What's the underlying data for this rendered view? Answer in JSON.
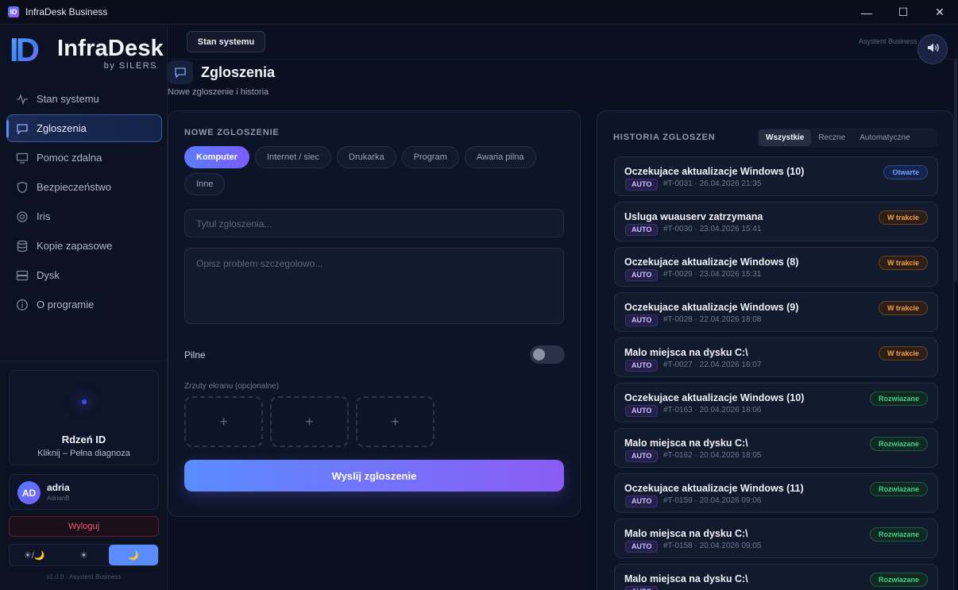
{
  "window": {
    "title": "InfraDesk Business",
    "app_icon": "ID",
    "controls": {
      "minimize": "—",
      "maximize": "☐",
      "close": "✕"
    }
  },
  "logo": {
    "mark": "ID",
    "name": "InfraDesk",
    "by": "by SILERS"
  },
  "sidebar": {
    "items": [
      {
        "label": "Stan systemu",
        "icon": "pulse-icon"
      },
      {
        "label": "Zgloszenia",
        "icon": "chat-icon",
        "active": true
      },
      {
        "label": "Pomoc zdalna",
        "icon": "monitor-icon"
      },
      {
        "label": "Bezpieczeństwo",
        "icon": "shield-icon"
      },
      {
        "label": "Iris",
        "icon": "eye-icon"
      },
      {
        "label": "Kopie zapasowe",
        "icon": "database-icon"
      },
      {
        "label": "Dysk",
        "icon": "server-icon"
      },
      {
        "label": "O programie",
        "icon": "info-icon"
      }
    ],
    "core": {
      "title": "Rdzeń ID",
      "subtitle": "Kliknij – Pełna diagnoza"
    },
    "user": {
      "initials": "AD",
      "name": "adria",
      "sub": "AdrianB"
    },
    "logout": "Wyloguj",
    "theme": {
      "auto": "☀/🌙",
      "light": "☀",
      "dark": "🌙"
    },
    "version": "v1.0.0 · Asystent Business"
  },
  "topbar": {
    "button": "Stan systemu",
    "assistant": "Asystent Business ·"
  },
  "page": {
    "title": "Zgloszenia",
    "subtitle": "Nowe zgloszenie i historia"
  },
  "new_ticket": {
    "label": "NOWE ZGLOSZENIE",
    "categories": [
      "Komputer",
      "Internet / siec",
      "Drukarka",
      "Program",
      "Awaria pilna",
      "Inne"
    ],
    "selected_category": "Komputer",
    "title_placeholder": "Tytul zgloszenia...",
    "desc_placeholder": "Opisz problem szczegolowo...",
    "urgent_label": "Pilne",
    "urgent": false,
    "screens_label": "Zrzuty ekranu (opcjonalne)",
    "slot_glyph": "+",
    "submit": "Wyslij zgloszenie"
  },
  "history": {
    "label": "HISTORIA ZGLOSZEN",
    "tabs": [
      "Wszystkie",
      "Reczne",
      "Automatyczne"
    ],
    "active_tab": "Wszystkie",
    "tickets": [
      {
        "title": "Oczekujace aktualizacje Windows (10)",
        "tag": "AUTO",
        "meta": "#T-0031 · 26.04.2026 21:35",
        "status": "Otwarte",
        "kind": "open"
      },
      {
        "title": "Usluga wuauserv zatrzymana",
        "tag": "AUTO",
        "meta": "#T-0030 · 23.04.2026 15:41",
        "status": "W trakcie",
        "kind": "prog"
      },
      {
        "title": "Oczekujace aktualizacje Windows (8)",
        "tag": "AUTO",
        "meta": "#T-0029 · 23.04.2026 15:31",
        "status": "W trakcie",
        "kind": "prog"
      },
      {
        "title": "Oczekujace aktualizacje Windows (9)",
        "tag": "AUTO",
        "meta": "#T-0028 · 22.04.2026 18:08",
        "status": "W trakcie",
        "kind": "prog"
      },
      {
        "title": "Malo miejsca na dysku C:\\",
        "tag": "AUTO",
        "meta": "#T-0027 · 22.04.2026 18:07",
        "status": "W trakcie",
        "kind": "prog"
      },
      {
        "title": "Oczekujace aktualizacje Windows (10)",
        "tag": "AUTO",
        "meta": "#T-0163 · 20.04.2026 18:06",
        "status": "Rozwiazane",
        "kind": "done"
      },
      {
        "title": "Malo miejsca na dysku C:\\",
        "tag": "AUTO",
        "meta": "#T-0162 · 20.04.2026 18:05",
        "status": "Rozwiazane",
        "kind": "done"
      },
      {
        "title": "Oczekujace aktualizacje Windows (11)",
        "tag": "AUTO",
        "meta": "#T-0159 · 20.04.2026 09:06",
        "status": "Rozwiazane",
        "kind": "done"
      },
      {
        "title": "Malo miejsca na dysku C:\\",
        "tag": "AUTO",
        "meta": "#T-0158 · 20.04.2026 09:05",
        "status": "Rozwiazane",
        "kind": "done"
      },
      {
        "title": "Malo miejsca na dysku C:\\",
        "tag": "AUTO",
        "meta": "",
        "status": "Rozwiazane",
        "kind": "done"
      }
    ]
  },
  "colors": {
    "accent": "#5b8cff",
    "accent2": "#8b5cf6",
    "open": "#6ea0ff",
    "in_progress": "#f0a050",
    "resolved": "#43d08a",
    "danger": "#ef5f6f"
  }
}
